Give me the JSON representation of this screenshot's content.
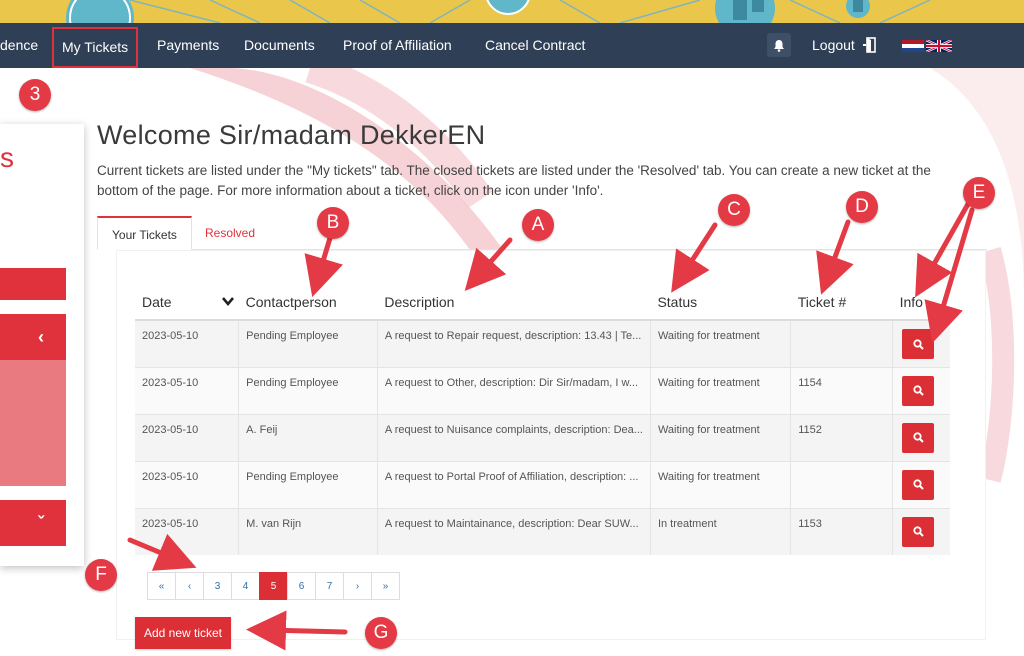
{
  "nav": {
    "items": [
      {
        "label": "dence"
      },
      {
        "label": "My Tickets"
      },
      {
        "label": "Payments"
      },
      {
        "label": "Documents"
      },
      {
        "label": "Proof of Affiliation"
      },
      {
        "label": "Cancel Contract"
      }
    ],
    "logout": "Logout"
  },
  "side_panel": {
    "letter": "s",
    "collapse_chevron": "‹",
    "expand_chevron": "ˇ"
  },
  "main": {
    "title": "Welcome Sir/madam DekkerEN",
    "intro": "Current tickets are listed under the \"My tickets\" tab. The closed tickets are listed under the 'Resolved' tab. You can create a new ticket at the bottom of the page. For more information about a ticket, click on the icon under 'Info'."
  },
  "tabs": [
    {
      "label": "Your Tickets"
    },
    {
      "label": "Resolved"
    }
  ],
  "table": {
    "headers": [
      "Date",
      "Contactperson",
      "Description",
      "Status",
      "Ticket #",
      "Info"
    ],
    "rows": [
      {
        "date": "2023-05-10",
        "contact": "Pending Employee",
        "description": "A request to Repair request, description: 13.43 | Te...",
        "status": "Waiting for treatment",
        "ticket": ""
      },
      {
        "date": "2023-05-10",
        "contact": "Pending Employee",
        "description": "A request to Other, description: Dir Sir/madam, I w...",
        "status": "Waiting for treatment",
        "ticket": "1154"
      },
      {
        "date": "2023-05-10",
        "contact": "A. Feij",
        "description": "A request to Nuisance complaints, description: Dea...",
        "status": "Waiting for treatment",
        "ticket": "1152"
      },
      {
        "date": "2023-05-10",
        "contact": "Pending Employee",
        "description": "A request to Portal Proof of Affiliation, description: ...",
        "status": "Waiting for treatment",
        "ticket": ""
      },
      {
        "date": "2023-05-10",
        "contact": "M. van Rijn",
        "description": "A request to Maintainance, description: Dear SUW...",
        "status": "In treatment",
        "ticket": "1153"
      }
    ]
  },
  "pagination": {
    "items": [
      "«",
      "‹",
      "3",
      "4",
      "5",
      "6",
      "7",
      "›",
      "»"
    ],
    "current": "5"
  },
  "add_button": "Add new ticket",
  "annotations": [
    "3",
    "A",
    "B",
    "C",
    "D",
    "E",
    "F",
    "G"
  ],
  "colors": {
    "accent": "#dc2f35",
    "navbar": "#2f3f56",
    "banner": "#eac64a",
    "annotation": "#e33a45"
  },
  "icons": [
    "bell-icon",
    "logout-door-icon",
    "flag-nl-icon",
    "flag-uk-icon",
    "search-icon",
    "sort-chevron-icon"
  ]
}
